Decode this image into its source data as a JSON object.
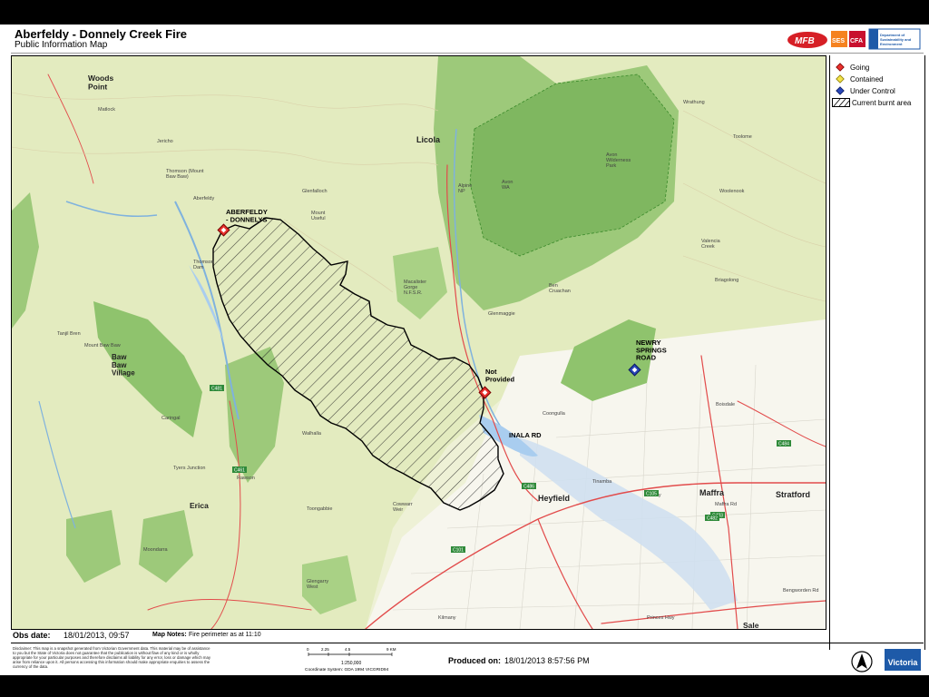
{
  "header": {
    "title": "Aberfeldy - Donnely Creek Fire",
    "subtitle": "Public Information Map",
    "logos": {
      "mfb": "MFB",
      "ses": "SES",
      "cfa": "CFA",
      "dse": "Department of Sustainability and Environment"
    }
  },
  "legend": {
    "items": [
      {
        "label": "Going",
        "color": "#e8312d",
        "icon": "going-diamond-icon"
      },
      {
        "label": "Contained",
        "color": "#f2e24a",
        "icon": "contained-diamond-icon"
      },
      {
        "label": "Under Control",
        "color": "#2846b8",
        "icon": "under-control-diamond-icon"
      },
      {
        "label": "Current burnt area",
        "icon": "burnt-area-hatch-icon"
      }
    ]
  },
  "map": {
    "fire_labels": {
      "aberfeldy": "ABERFELDY\n- DONNELYS",
      "not_provided": "Not\nProvided",
      "inala": "INALA RD",
      "newry": "NEWRY\nSPRINGS\nROAD"
    },
    "towns": [
      {
        "name": "Woods\nPoint",
        "key": "woods_point"
      },
      {
        "name": "Licola",
        "key": "licola"
      },
      {
        "name": "Heyfield",
        "key": "heyfield"
      },
      {
        "name": "Maffra",
        "key": "maffra"
      },
      {
        "name": "Stratford",
        "key": "stratford"
      },
      {
        "name": "Baw\nBaw\nVillage",
        "key": "baw_baw"
      },
      {
        "name": "Erica",
        "key": "erica"
      },
      {
        "name": "Sale",
        "key": "sale"
      }
    ],
    "minor_labels": [
      "Matlock",
      "Jericho",
      "Aberfeldy",
      "Thomson (Mount\nBaw Baw)",
      "Glenfalloch",
      "Mount\nUseful",
      "Alpine\nNP",
      "Avon\nWA",
      "Avon\nWilderness\nPark",
      "Wrathung",
      "Toolome",
      "Woolenook",
      "Valencia\nCreek",
      "Briagolong",
      "Ben\nCruachan",
      "Glenmaggie",
      "Coongulla",
      "Boisdale",
      "Tinamba",
      "Newry",
      "Walhalla",
      "Tanjil Bren",
      "Caringal",
      "Rawson",
      "Cowwarr\nWeir",
      "Toongabbie",
      "Glengarry\nWest",
      "Moondarra",
      "Tyers Junction",
      "Kilmany",
      "Mount Baw Baw",
      "Thomson\nDam",
      "Maffra Rd",
      "Princes Hwy",
      "Bengworden Rd",
      "Macalister\nGorge\nN.F.S.R."
    ],
    "roads": [
      "C481",
      "C486",
      "C461",
      "C105",
      "C101",
      "C483",
      "C484",
      "C482"
    ]
  },
  "obs": {
    "label": "Obs date:",
    "value": "18/01/2013, 09:57",
    "notes_label": "Map Notes:",
    "notes_value": "Fire perimeter as at 11:10"
  },
  "footer": {
    "disclaimer": "Disclaimer: This map is a snapshot generated from Victorian Government data. This material may be of assistance to you but the State of Victoria does not guarantee that the publication is without flaw of any kind or is wholly appropriate for your particular purposes and therefore disclaims all liability for any error, loss or damage which may arise from reliance upon it. All persons accessing this information should make appropriate enquiries to assess the currency of the data.",
    "scale_ticks": [
      "0",
      "2.25",
      "4.5",
      "9 KM"
    ],
    "scale_ratio": "1:250,000",
    "coord_system": "Coordinate System: GDA 1994 VICGRID94",
    "produced_label": "Produced on:",
    "produced_value": "18/01/2013 8:57:56 PM",
    "victoria": "Victoria"
  }
}
